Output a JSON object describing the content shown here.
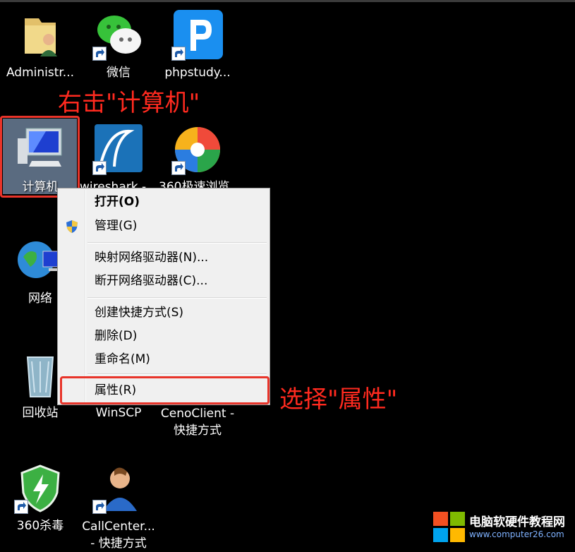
{
  "desktop": {
    "icons": [
      {
        "label": "Administr..."
      },
      {
        "label": "微信"
      },
      {
        "label": "phpstudy..."
      },
      {
        "label": "计算机"
      },
      {
        "label": "wireshark - ..."
      },
      {
        "label": "360极速浏览..."
      },
      {
        "label": "网络"
      },
      {
        "label": "回收站"
      },
      {
        "label": "WinSCP"
      },
      {
        "label": "CenoClient - 快捷方式"
      },
      {
        "label": "360杀毒"
      },
      {
        "label": "CallCenter... - 快捷方式"
      }
    ]
  },
  "annotations": {
    "step1": "右击\"计算机\"",
    "step2": "选择\"属性\""
  },
  "context_menu": {
    "items": [
      {
        "label": "打开(O)"
      },
      {
        "label": "管理(G)"
      },
      {
        "label": "映射网络驱动器(N)..."
      },
      {
        "label": "断开网络驱动器(C)..."
      },
      {
        "label": "创建快捷方式(S)"
      },
      {
        "label": "删除(D)"
      },
      {
        "label": "重命名(M)"
      },
      {
        "label": "属性(R)"
      }
    ]
  },
  "watermark": {
    "title": "电脑软硬件教程网",
    "url": "www.computer26.com"
  },
  "colors": {
    "annotation": "#ff2a1f",
    "menu_background": "#f0f0f0",
    "desktop_background": "#000000"
  }
}
